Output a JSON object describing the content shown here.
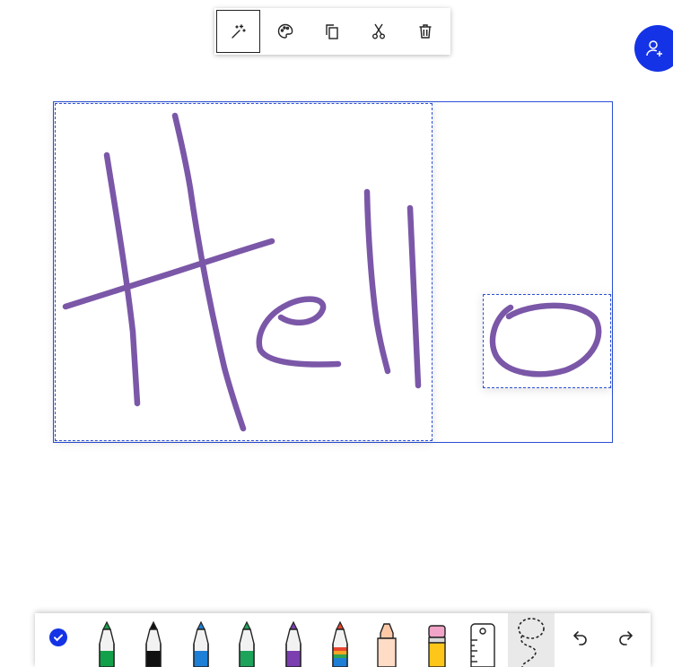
{
  "selection_toolbar": {
    "items": [
      {
        "id": "ink-effects",
        "icon": "magic-wand-icon",
        "active": true
      },
      {
        "id": "color",
        "icon": "palette-icon",
        "active": false
      },
      {
        "id": "copy",
        "icon": "copy-icon",
        "active": false
      },
      {
        "id": "cut",
        "icon": "scissors-icon",
        "active": false
      },
      {
        "id": "delete",
        "icon": "trash-icon",
        "active": false
      }
    ]
  },
  "fab": {
    "icon": "add-person-icon",
    "color": "#1433e6"
  },
  "canvas": {
    "ink_color": "#7b57a8",
    "selection_color": "#2b4fd8",
    "handwriting": "Hello"
  },
  "pen_bar": {
    "pens": [
      {
        "name": "green-pen",
        "color": "#13a04a"
      },
      {
        "name": "black-pen",
        "color": "#111111"
      },
      {
        "name": "blue-pen",
        "color": "#1e7fd6"
      },
      {
        "name": "green-pen-2",
        "color": "#1da35a"
      },
      {
        "name": "purple-pen",
        "color": "#7b3fb0"
      },
      {
        "name": "rainbow-pen",
        "color": "#e8462f"
      }
    ],
    "highlighters": [
      {
        "name": "peach-highlighter",
        "color": "#ffc9a8"
      },
      {
        "name": "pink-eraser-pencil",
        "color": "#f2a3c8"
      }
    ],
    "tools": [
      "ruler-icon",
      "lasso-icon"
    ],
    "active_tool": "lasso"
  }
}
